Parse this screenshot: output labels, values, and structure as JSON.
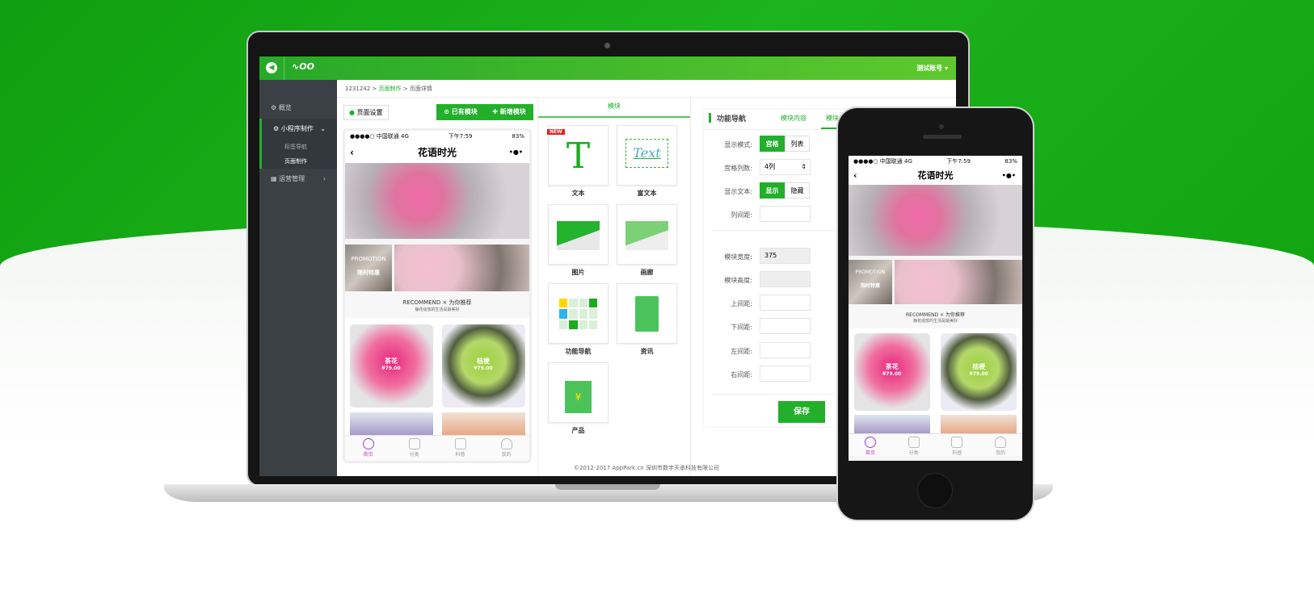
{
  "app": {
    "user_menu": "测试账号 ▾",
    "logo_text": "APP"
  },
  "sidebar": {
    "items": [
      {
        "label": "概览",
        "icon": "gear-icon"
      },
      {
        "label": "小程序制作",
        "icon": "gear-icon",
        "sub": [
          "标签导航",
          "页面制作"
        ]
      },
      {
        "label": "运营管理",
        "icon": "grid-icon"
      }
    ]
  },
  "breadcrumb": [
    "1231242",
    ">",
    "页面制作",
    ">",
    "页面详情"
  ],
  "toolbar": {
    "page_settings": "页面设置",
    "existing_modules": "已有模块",
    "add_module": "新增模块"
  },
  "preview": {
    "carrier": "●●●●○ 中国联通  4G",
    "time": "下午7:59",
    "battery": "83%",
    "title": "花语时光",
    "more": "•●•",
    "promo_label": "PROMOTION",
    "promo_sub": "限时特惠",
    "recommend": "RECOMMEND × 为你推荐",
    "recommend_sub": "静花绽放的生活是最美好",
    "products": [
      {
        "name": "茶花",
        "price": "¥79.00"
      },
      {
        "name": "桔梗",
        "price": "¥79.00"
      }
    ],
    "tabs": [
      "首页",
      "分类",
      "科普",
      "我的"
    ]
  },
  "modules": {
    "tab": "模块",
    "new_badge": "NEW",
    "items": [
      "文本",
      "富文本",
      "图片",
      "画廊",
      "功能导航",
      "资讯",
      "产品"
    ],
    "richtext_sample": "Text"
  },
  "settings": {
    "title": "功能导航",
    "tabs": [
      "模块内容",
      "模块样式"
    ],
    "display_mode": {
      "label": "显示模式:",
      "options": [
        "宫格",
        "列表"
      ],
      "selected": "宫格"
    },
    "columns": {
      "label": "宫格列数:",
      "value": "4列"
    },
    "show_text": {
      "label": "显示文本:",
      "options": [
        "显示",
        "隐藏"
      ],
      "selected": "显示"
    },
    "col_gap": {
      "label": "列间距:",
      "value": ""
    },
    "width": {
      "label": "模块宽度:",
      "value": "375"
    },
    "height": {
      "label": "模块高度:",
      "value": ""
    },
    "top": {
      "label": "上间距:",
      "value": ""
    },
    "bottom": {
      "label": "下间距:",
      "value": ""
    },
    "left": {
      "label": "左间距:",
      "value": ""
    },
    "right": {
      "label": "右间距:",
      "value": ""
    },
    "save": "保存"
  },
  "footer": "©2012-2017 AppPark.cn 深圳市数字天承科技有限公司",
  "colors": {
    "brand_green": "#22b02a",
    "sidebar": "#3b4045",
    "accent_pink": "#e8267e"
  }
}
